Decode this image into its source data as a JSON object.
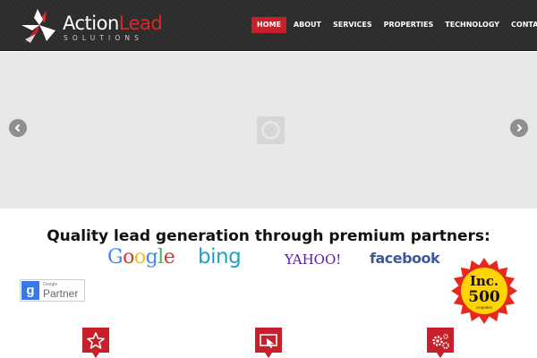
{
  "logo": {
    "word1": "Action",
    "word2": "Lead",
    "tagline": "SOLUTIONS"
  },
  "nav": {
    "items": [
      {
        "label": "HOME",
        "active": true
      },
      {
        "label": "ABOUT",
        "active": false
      },
      {
        "label": "SERVICES",
        "active": false
      },
      {
        "label": "PROPERTIES",
        "active": false
      },
      {
        "label": "TECHNOLOGY",
        "active": false
      },
      {
        "label": "CONTACT",
        "active": false
      }
    ]
  },
  "slider": {
    "prev_icon": "chevron-left-icon",
    "next_icon": "chevron-right-icon",
    "loader_icon": "loading-spinner-icon"
  },
  "headline": "Quality lead generation through premium partners:",
  "partners": {
    "google": "Google",
    "bing": "bing",
    "yahoo": "YAHOO!",
    "facebook": "facebook"
  },
  "google_partner_badge": {
    "letter": "g",
    "small": "Google",
    "label": "Partner"
  },
  "inc_seal": {
    "brand": "Inc.",
    "number": "500",
    "caption": "HONOREE"
  },
  "features": [
    {
      "icon": "star-icon"
    },
    {
      "icon": "monitor-cursor-icon"
    },
    {
      "icon": "gears-icon"
    }
  ],
  "colors": {
    "accent": "#c8202a",
    "header_bg": "#2b2b2b",
    "slider_bg": "#e8e8e8",
    "google_blue": "#4285f4",
    "google_red": "#db3236",
    "google_yellow": "#f4c20d",
    "google_green": "#3cba54",
    "bing": "#1ea2c8",
    "yahoo": "#5a1ba8",
    "facebook": "#3b5998"
  }
}
